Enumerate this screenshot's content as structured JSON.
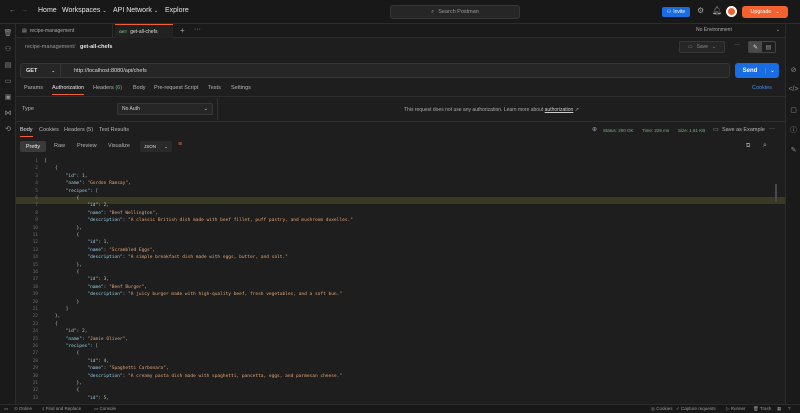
{
  "nav": {
    "home": "Home",
    "workspaces": "Workspaces",
    "api_network": "API Network",
    "explore": "Explore",
    "search_placeholder": "Search Postman",
    "invite": "Invite",
    "upgrade": "Upgrade"
  },
  "tabs": {
    "items": [
      {
        "label": "recipe-management",
        "method": ""
      },
      {
        "label": "get-all-chefs",
        "method": "GET"
      }
    ],
    "env": "No Environment"
  },
  "breadcrumb": {
    "collection": "recipe-management",
    "request": "get-all-chefs",
    "save": "Save"
  },
  "request": {
    "method": "GET",
    "url": "http://localhost:8080/api/chefs",
    "send": "Send"
  },
  "request_tabs": {
    "params": "Params",
    "authorization": "Authorization",
    "headers": "Headers",
    "headers_count": "(6)",
    "body": "Body",
    "prerequest": "Pre-request Script",
    "tests": "Tests",
    "settings": "Settings",
    "cookies": "Cookies"
  },
  "auth": {
    "type_label": "Type",
    "type_value": "No Auth",
    "message": "This request does not use any authorization. Learn more about",
    "link": "authorization"
  },
  "response_tabs": {
    "body": "Body",
    "cookies": "Cookies",
    "headers": "Headers (5)",
    "test_results": "Test Results",
    "status": "Status: 200 OK",
    "time": "Time: 225 ms",
    "size": "Size: 1.61 KB",
    "save_example": "Save as Example"
  },
  "view_tabs": {
    "pretty": "Pretty",
    "raw": "Raw",
    "preview": "Preview",
    "visualize": "Visualize",
    "format": "JSON"
  },
  "code_lines": [
    {
      "n": "1",
      "t": "["
    },
    {
      "n": "2",
      "t": "    {"
    },
    {
      "n": "3",
      "t": "        \"id\": 1,"
    },
    {
      "n": "4",
      "t": "        \"name\": \"Gordon Ramsay\","
    },
    {
      "n": "5",
      "t": "        \"recipes\": ["
    },
    {
      "n": "6",
      "t": "            {"
    },
    {
      "n": "7",
      "t": "                \"id\": 2,"
    },
    {
      "n": "8",
      "t": "                \"name\": \"Beef Wellington\","
    },
    {
      "n": "9",
      "t": "                \"description\": \"A classic British dish made with beef fillet, puff pastry, and mushroom duxelles.\""
    },
    {
      "n": "10",
      "t": "            },"
    },
    {
      "n": "11",
      "t": "            {"
    },
    {
      "n": "12",
      "t": "                \"id\": 1,"
    },
    {
      "n": "13",
      "t": "                \"name\": \"Scrambled Eggs\","
    },
    {
      "n": "14",
      "t": "                \"description\": \"A simple breakfast dish made with eggs, butter, and salt.\""
    },
    {
      "n": "15",
      "t": "            },"
    },
    {
      "n": "16",
      "t": "            {"
    },
    {
      "n": "17",
      "t": "                \"id\": 3,"
    },
    {
      "n": "18",
      "t": "                \"name\": \"Beef Burger\","
    },
    {
      "n": "19",
      "t": "                \"description\": \"A juicy burger made with high-quality beef, fresh vegetables, and a soft bun.\""
    },
    {
      "n": "20",
      "t": "            }"
    },
    {
      "n": "21",
      "t": "        ]"
    },
    {
      "n": "22",
      "t": "    },"
    },
    {
      "n": "23",
      "t": "    {"
    },
    {
      "n": "24",
      "t": "        \"id\": 2,"
    },
    {
      "n": "25",
      "t": "        \"name\": \"Jamie Oliver\","
    },
    {
      "n": "26",
      "t": "        \"recipes\": ["
    },
    {
      "n": "27",
      "t": "            {"
    },
    {
      "n": "28",
      "t": "                \"id\": 4,"
    },
    {
      "n": "29",
      "t": "                \"name\": \"Spaghetti Carbonara\","
    },
    {
      "n": "30",
      "t": "                \"description\": \"A creamy pasta dish made with spaghetti, pancetta, eggs, and parmesan cheese.\""
    },
    {
      "n": "31",
      "t": "            },"
    },
    {
      "n": "32",
      "t": "            {"
    },
    {
      "n": "33",
      "t": "                \"id\": 5,"
    }
  ],
  "statusbar": {
    "online": "Online",
    "find_replace": "Find and Replace",
    "console": "Console",
    "cookies": "Cookies",
    "capture": "Capture requests",
    "runner": "Runner",
    "trash": "Trash"
  }
}
